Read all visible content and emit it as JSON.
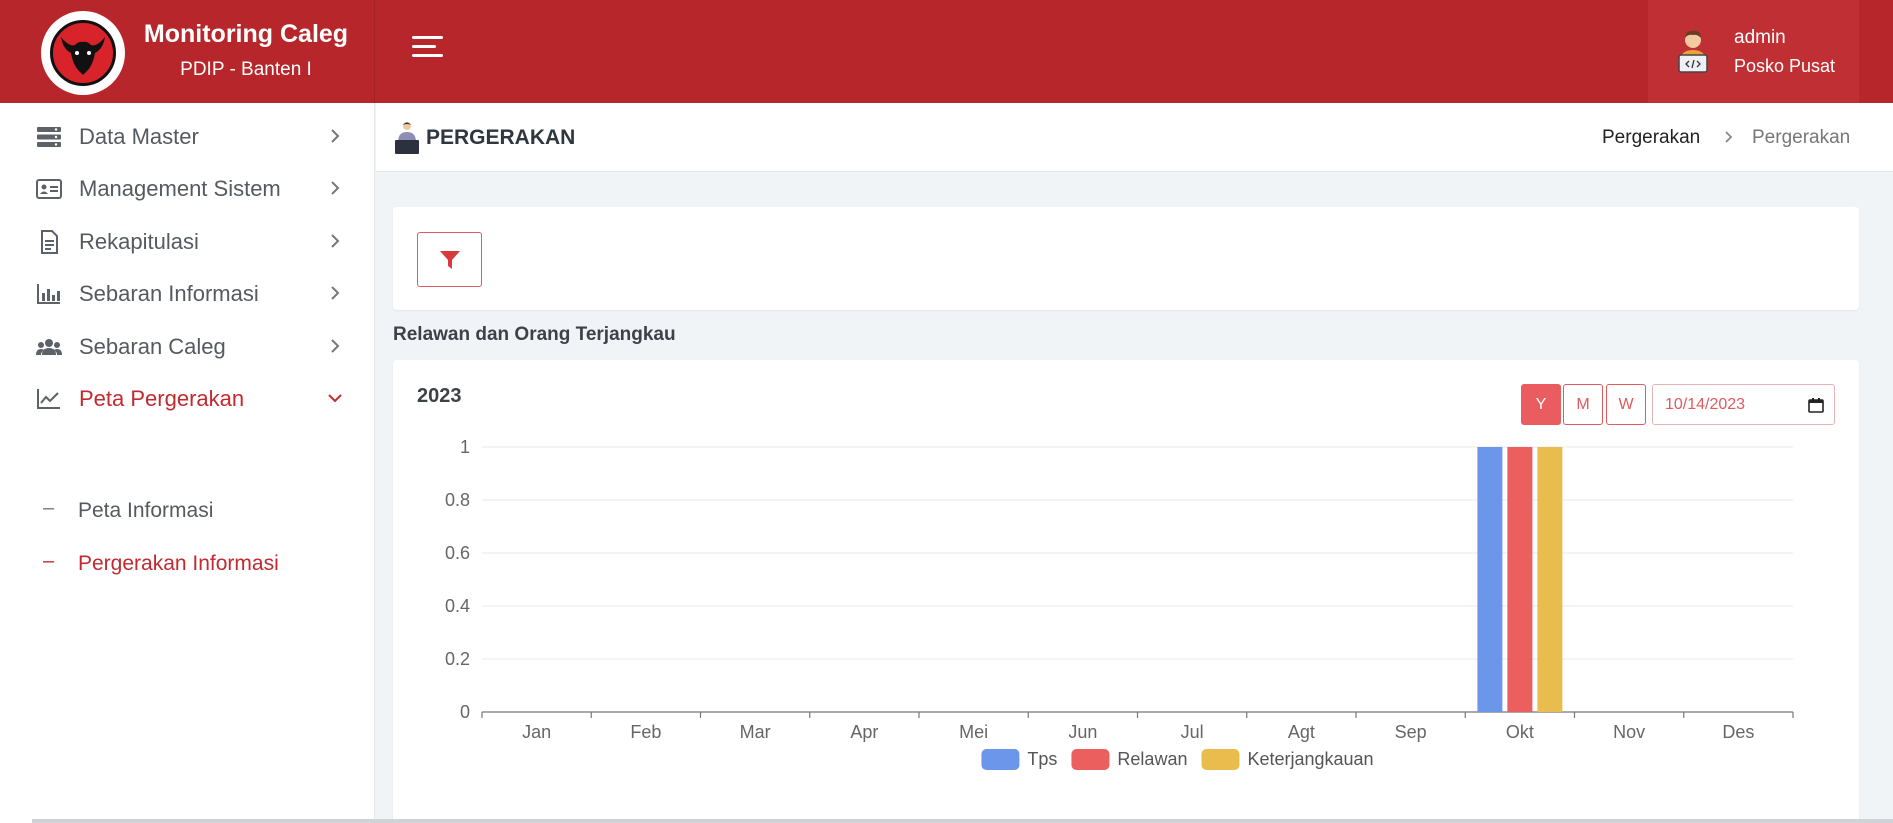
{
  "brand": {
    "title": "Monitoring Caleg",
    "subtitle": "PDIP - Banten I"
  },
  "user": {
    "name": "admin",
    "role": "Posko Pusat"
  },
  "sidebar": {
    "items": [
      {
        "label": "Data Master",
        "icon": "server-icon"
      },
      {
        "label": "Management Sistem",
        "icon": "id-card-icon"
      },
      {
        "label": "Rekapitulasi",
        "icon": "document-icon"
      },
      {
        "label": "Sebaran Informasi",
        "icon": "bar-chart-icon"
      },
      {
        "label": "Sebaran Caleg",
        "icon": "users-icon"
      },
      {
        "label": "Peta Pergerakan",
        "icon": "line-chart-icon",
        "active": true
      }
    ],
    "subitems": [
      {
        "label": "Peta Informasi",
        "dash": "–"
      },
      {
        "label": "Pergerakan Informasi",
        "dash": "–",
        "active": true
      }
    ]
  },
  "page": {
    "title": "PERGERAKAN",
    "breadcrumb": [
      "Pergerakan",
      "Pergerakan"
    ]
  },
  "section_title": "Relawan dan Orang Terjangkau",
  "chart_card": {
    "year": "2023",
    "period_buttons": [
      "Y",
      "M",
      "W"
    ],
    "selected_period": "Y",
    "date_value": "10/14/2023"
  },
  "colors": {
    "primary": "#b7262a",
    "accent": "#eb5c60",
    "tps": "#6b96ea",
    "relawan": "#ec5f5f",
    "keterjangkauan": "#e8bd4e"
  },
  "chart_data": {
    "type": "bar",
    "categories": [
      "Jan",
      "Feb",
      "Mar",
      "Apr",
      "Mei",
      "Jun",
      "Jul",
      "Agt",
      "Sep",
      "Okt",
      "Nov",
      "Des"
    ],
    "series": [
      {
        "name": "Tps",
        "values": [
          0,
          0,
          0,
          0,
          0,
          0,
          0,
          0,
          0,
          1,
          0,
          0
        ],
        "color": "#6b96ea"
      },
      {
        "name": "Relawan",
        "values": [
          0,
          0,
          0,
          0,
          0,
          0,
          0,
          0,
          0,
          1,
          0,
          0
        ],
        "color": "#ec5f5f"
      },
      {
        "name": "Keterjangkauan",
        "values": [
          0,
          0,
          0,
          0,
          0,
          0,
          0,
          0,
          0,
          1,
          0,
          0
        ],
        "color": "#e8bd4e"
      }
    ],
    "yticks": [
      "0",
      "0.2",
      "0.4",
      "0.6",
      "0.8",
      "1"
    ],
    "ylim": [
      0,
      1
    ],
    "grid": true,
    "legend": "bottom-center"
  }
}
